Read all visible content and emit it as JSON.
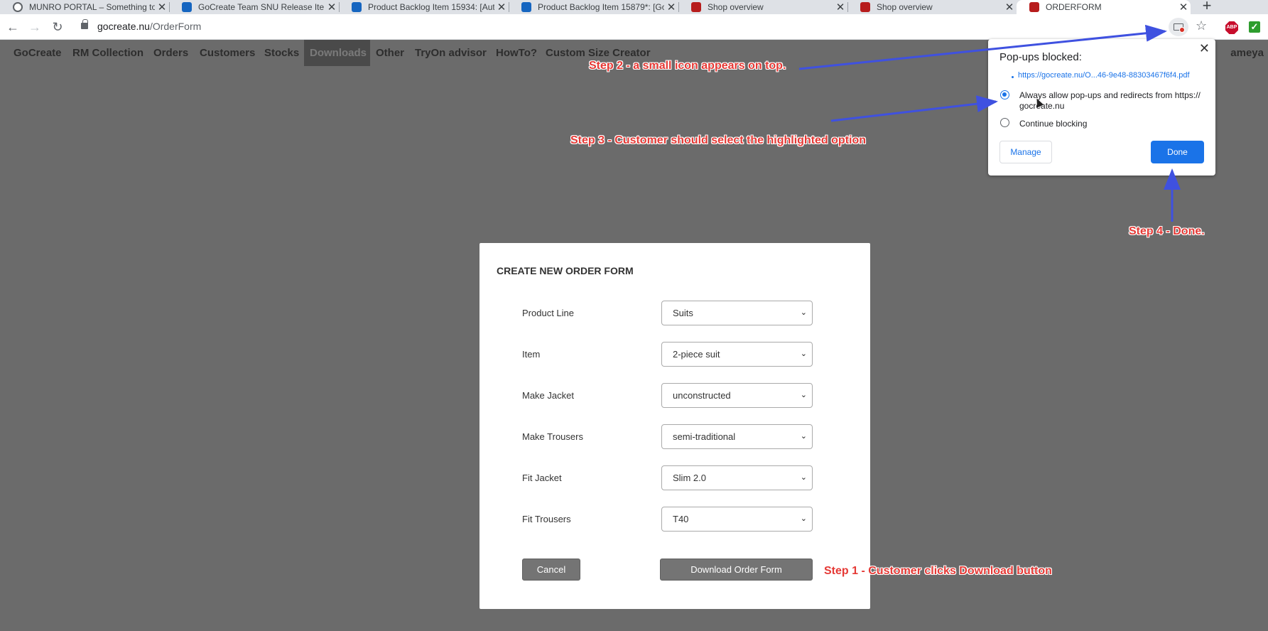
{
  "browser": {
    "tabs": [
      {
        "title": "MUNRO PORTAL – Something to",
        "icon": "globe-icon"
      },
      {
        "title": "GoCreate Team SNU Release Item",
        "icon": "azure-devops-icon"
      },
      {
        "title": "Product Backlog Item 15934: [Aut",
        "icon": "azure-devops-icon"
      },
      {
        "title": "Product Backlog Item 15879*: [Go",
        "icon": "azure-devops-icon"
      },
      {
        "title": "Shop overview",
        "icon": "shop-icon"
      },
      {
        "title": "Shop overview",
        "icon": "shop-icon"
      },
      {
        "title": "ORDERFORM",
        "icon": "shop-icon"
      }
    ],
    "new_tab": "+",
    "url_host": "gocreate.nu",
    "url_path": "/OrderForm"
  },
  "nav": {
    "items": [
      "GoCreate",
      "RM Collection",
      "Orders",
      "Customers",
      "Stocks",
      "Downloads",
      "Other",
      "TryOn advisor",
      "HowTo?",
      "Custom Size Creator"
    ],
    "active": "Downloads",
    "user": "ameya"
  },
  "form": {
    "title": "CREATE NEW ORDER FORM",
    "fields": [
      {
        "label": "Product Line",
        "value": "Suits"
      },
      {
        "label": "Item",
        "value": "2-piece suit"
      },
      {
        "label": "Make Jacket",
        "value": "unconstructed"
      },
      {
        "label": "Make Trousers",
        "value": "semi-traditional"
      },
      {
        "label": "Fit Jacket",
        "value": "Slim 2.0"
      },
      {
        "label": "Fit Trousers",
        "value": "T40"
      }
    ],
    "cancel_label": "Cancel",
    "download_label": "Download Order Form"
  },
  "popup_bubble": {
    "title": "Pop-ups blocked:",
    "link": "https://gocreate.nu/O...46-9e48-88303467f6f4.pdf",
    "option_allow_line1": "Always allow pop-ups and redirects from https://",
    "option_allow_line2": "gocreate.nu",
    "option_block": "Continue blocking",
    "manage_label": "Manage",
    "done_label": "Done",
    "close": "✕"
  },
  "annotations": {
    "step1": "Step 1 - Customer clicks Download button",
    "step2": "Step 2 - a small icon appears on top.",
    "step3": "Step 3 - Customer should select the highlighted option",
    "step4": "Step 4 - Done.",
    "color": "#e53935",
    "arrow_color": "#3f51e0"
  },
  "colors": {
    "page_bg": "#6b6b6b",
    "accent": "#1a73e8"
  }
}
